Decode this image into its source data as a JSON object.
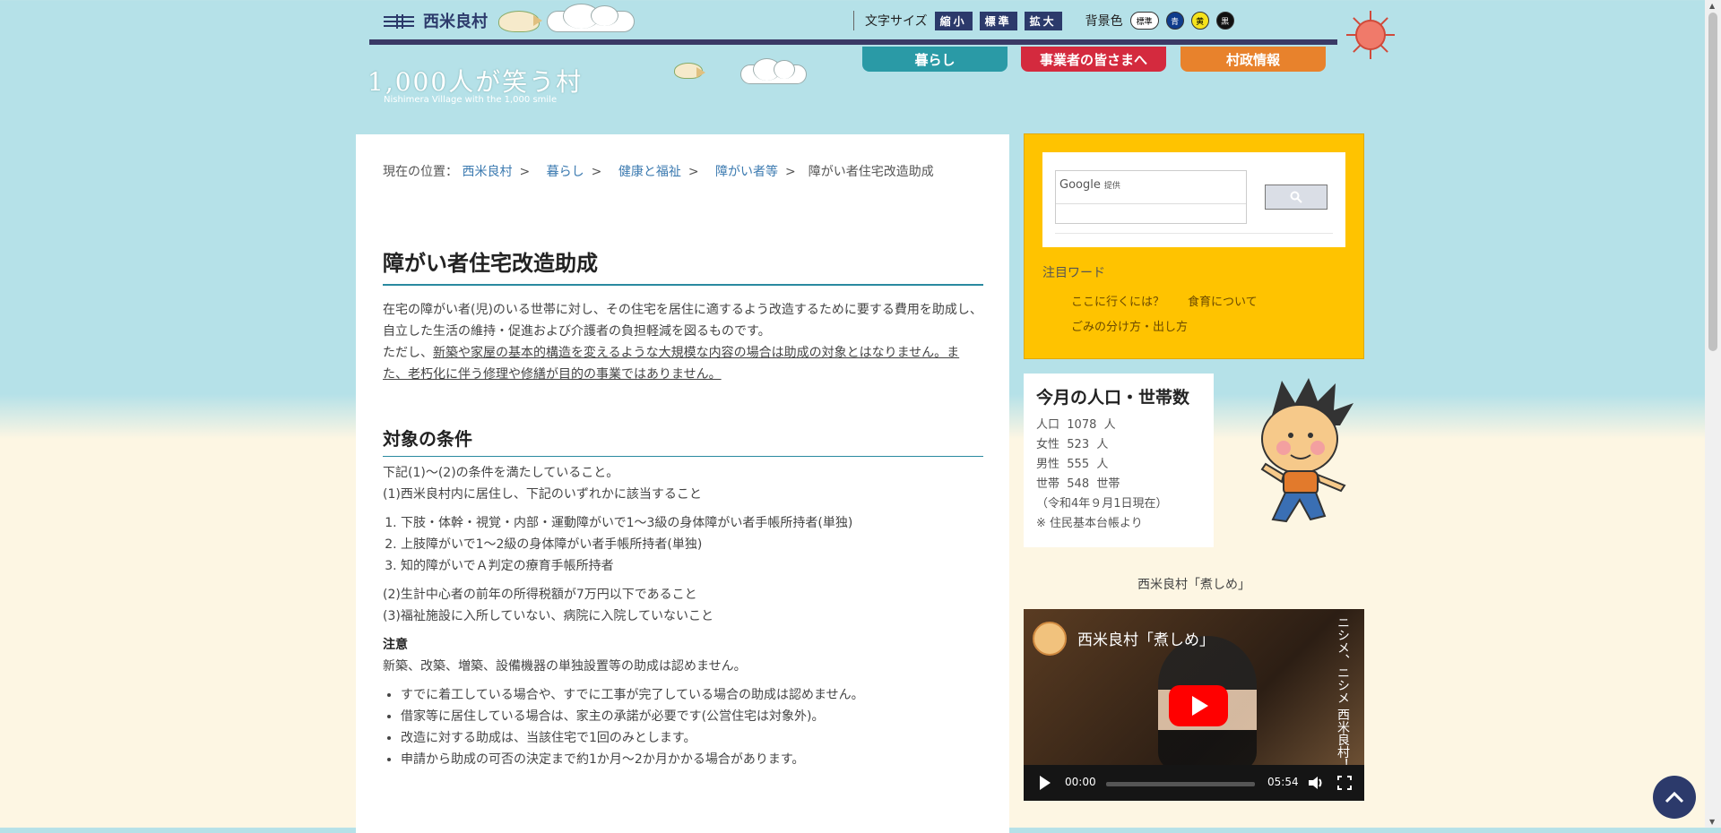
{
  "header": {
    "village_name": "西米良村",
    "catchphrase": "1,000人が笑う村",
    "catchphrase_sub": "Nishimera Village with the 1,000 smile",
    "font_size_label": "文字サイズ",
    "font_size_buttons": [
      "縮小",
      "標準",
      "拡大"
    ],
    "bg_color_label": "背景色",
    "bg_color_buttons": [
      "標準",
      "青",
      "黄",
      "黒"
    ],
    "nav": [
      "暮らし",
      "事業者の皆さまへ",
      "村政情報"
    ]
  },
  "breadcrumb": {
    "prefix": "現在の位置：",
    "items": [
      "西米良村",
      "暮らし",
      "健康と福祉",
      "障がい者等"
    ],
    "separator": ">",
    "current": "障がい者住宅改造助成"
  },
  "page": {
    "title": "障がい者住宅改造助成",
    "intro": "在宅の障がい者(児)のいる世帯に対し、その住宅を居住に適するよう改造するために要する費用を助成し、自立した生活の維持・促進および介護者の負担軽減を図るものです。",
    "note_prefix": "ただし、",
    "note_underlined": "新築や家屋の基本的構造を変えるような大規模な内容の場合は助成の対象とはなりません。また、老朽化に伴う修理や修繕が目的の事業ではありません。",
    "section_title": "対象の条件",
    "cond_intro": "下記(1)～(2)の条件を満たしていること。",
    "cond_1": "(1)西米良村内に居住し、下記のいずれかに該当すること",
    "cond_list": [
      "下肢・体幹・視覚・内部・運動障がいで1～3級の身体障がい者手帳所持者(単独)",
      "上肢障がいで1～2級の身体障がい者手帳所持者(単独)",
      "知的障がいでＡ判定の療育手帳所持者"
    ],
    "cond_2": "(2)生計中心者の前年の所得税額が7万円以下であること",
    "cond_3": "(3)福祉施設に入所していない、病院に入院していないこと",
    "caution_title": "注意",
    "caution_text": "新築、改築、増築、設備機器の単独設置等の助成は認めません。",
    "caution_list": [
      "すでに着工している場合や、すでに工事が完了している場合の助成は認めません。",
      "借家等に居住している場合は、家主の承諾が必要です(公営住宅は対象外)。",
      "改造に対する助成は、当該住宅で1回のみとします。",
      "申請から助成の可否の決定まで約1か月～2か月かかる場合があります。"
    ]
  },
  "sidebar": {
    "search_brand": "Google",
    "search_brand_sub": "提供",
    "keywords_title": "注目ワード",
    "keywords": [
      "ここに行くには？",
      "食育について",
      "ごみの分け方・出し方"
    ],
    "population": {
      "title": "今月の人口・世帯数",
      "population_label": "人口",
      "population_value": "1078",
      "population_unit": "人",
      "female_label": "女性",
      "female_value": "523",
      "female_unit": "人",
      "male_label": "男性",
      "male_value": "555",
      "male_unit": "人",
      "household_label": "世帯",
      "household_value": "548",
      "household_unit": "世帯",
      "as_of": "（令和4年９月1日現在）",
      "source": "※ 住民基本台帳より"
    },
    "video_caption": "西米良村「煮しめ」",
    "video": {
      "title": "西米良村「煮しめ」",
      "side_text": "ニシメ、ニシメ 西米良村！",
      "current_time": "00:00",
      "duration": "05:54"
    }
  },
  "colors": {
    "sky": "#b5e1e8",
    "sand": "#fdf6e3",
    "navy": "#2c3a6b",
    "nav_life": "#2a9aa6",
    "nav_biz": "#d42a3e",
    "nav_gov": "#e8822c",
    "search_panel": "#ffc300",
    "link": "#3b7ab0"
  }
}
